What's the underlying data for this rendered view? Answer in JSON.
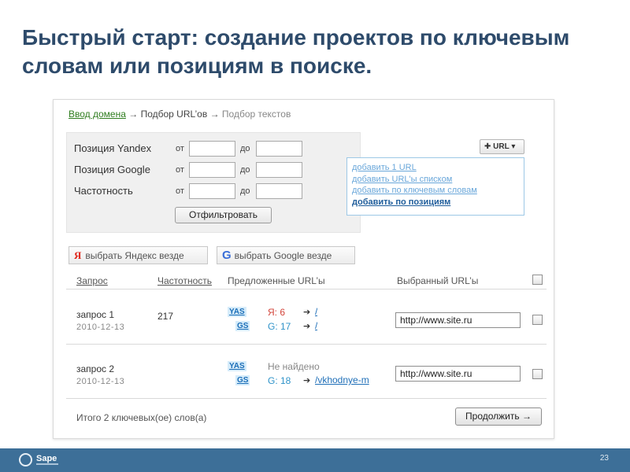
{
  "slide": {
    "title": "Быстрый старт: создание проектов по ключевым словам или позициям в поиске.",
    "page_number": "23",
    "logo_text": "Sape"
  },
  "breadcrumb": {
    "step1": "Ввод домена",
    "arrow": "→",
    "step2": "Подбор URL’ов",
    "step3": "Подбор текстов"
  },
  "filter": {
    "rows": [
      {
        "label": "Позиция Yandex",
        "from": "от",
        "to": "до"
      },
      {
        "label": "Позиция Google",
        "from": "от",
        "to": "до"
      },
      {
        "label": "Частотность",
        "from": "от",
        "to": "до"
      }
    ],
    "apply_button": "Отфильтровать"
  },
  "url_dropdown": {
    "button_label": "URL",
    "items": [
      "добавить 1 URL",
      "добавить URL'ы списком",
      "добавить по ключевым словам",
      "добавить по позициям"
    ]
  },
  "select_buttons": {
    "yandex_icon": "Я",
    "yandex": "выбрать Яндекс везде",
    "google_icon": "G",
    "google": "выбрать Google везде"
  },
  "table": {
    "headers": {
      "query": "Запрос",
      "frequency": "Частотность",
      "suggested": "Предложенные URL’ы",
      "selected": "Выбранный URL’ы"
    },
    "rows": [
      {
        "query": "запрос 1",
        "date": "2010-12-13",
        "frequency": "217",
        "yas_tag": "YAS",
        "gs_tag": "GS",
        "yandex_result": "Я: 6",
        "google_result": "G: 17",
        "yandex_link": "/",
        "google_link": "/",
        "selected_url": "http://www.site.ru"
      },
      {
        "query": "запрос 2",
        "date": "2010-12-13",
        "frequency": "",
        "yas_tag": "YAS",
        "gs_tag": "GS",
        "yandex_result": "Не найдено",
        "google_result": "G: 18",
        "yandex_link": "",
        "google_link": "/vkhodnye-m",
        "selected_url": "http://www.site.ru"
      }
    ],
    "total": "Итого 2 ключевых(ое) слов(а)",
    "continue_button": "Продолжить →"
  }
}
